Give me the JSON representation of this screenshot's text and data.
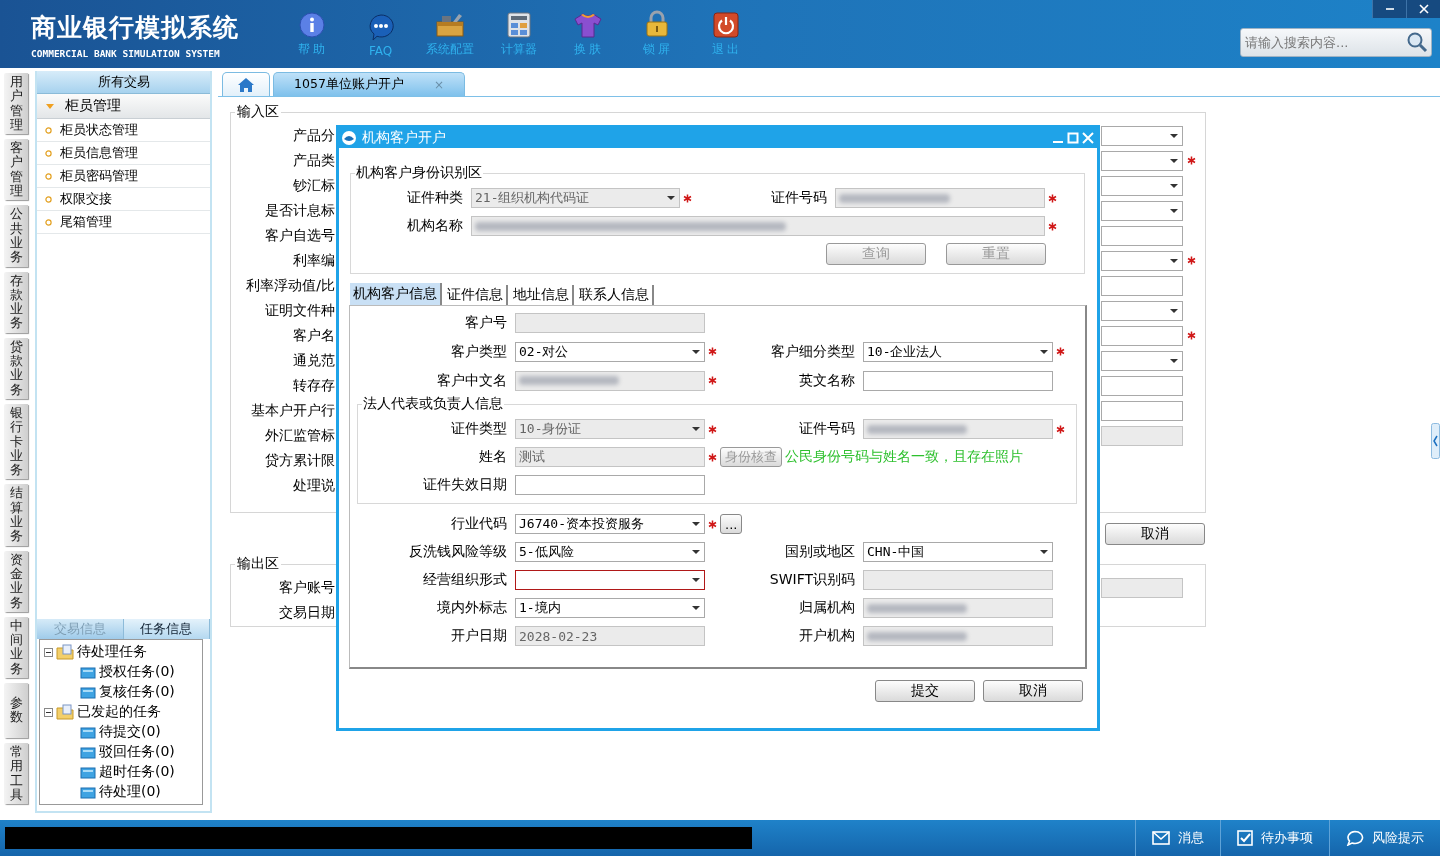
{
  "header": {
    "title": "商业银行模拟系统",
    "subtitle": "COMMERCIAL BANK SIMULATION SYSTEM",
    "toolbar": [
      {
        "kind": "info",
        "label": "帮 助"
      },
      {
        "kind": "faq",
        "label": "FAQ"
      },
      {
        "kind": "config",
        "label": "系统配置"
      },
      {
        "kind": "calculator",
        "label": "计算器"
      },
      {
        "kind": "skin",
        "label": "换 肤"
      },
      {
        "kind": "lock",
        "label": "锁 屏"
      },
      {
        "kind": "exit",
        "label": "退 出"
      }
    ],
    "search": {
      "placeholder": "请输入搜索内容..."
    }
  },
  "module_nav": [
    {
      "label": "用户管理"
    },
    {
      "label": "客户管理"
    },
    {
      "label": "公共业务"
    },
    {
      "label": "存款业务"
    },
    {
      "label": "贷款业务"
    },
    {
      "label": "银行卡业务"
    },
    {
      "label": "结算业务"
    },
    {
      "label": "资金业务"
    },
    {
      "label": "中间业务"
    },
    {
      "label": "参数"
    },
    {
      "label": "常用工具"
    }
  ],
  "sidebar": {
    "title": "所有交易",
    "group": {
      "label": "柜员管理",
      "expanded": true,
      "items": [
        {
          "label": "柜员状态管理"
        },
        {
          "label": "柜员信息管理"
        },
        {
          "label": "柜员密码管理"
        },
        {
          "label": "权限交接"
        },
        {
          "label": "尾箱管理"
        }
      ]
    },
    "bottom_tabs": [
      {
        "label": "交易信息",
        "selected": false
      },
      {
        "label": "任务信息",
        "selected": true
      }
    ],
    "tree": [
      {
        "label": "待处理任务",
        "expanded": true,
        "children": [
          {
            "label": "授权任务(0)"
          },
          {
            "label": "复核任务(0)"
          }
        ]
      },
      {
        "label": "已发起的任务",
        "expanded": true,
        "children": [
          {
            "label": "待提交(0)"
          },
          {
            "label": "驳回任务(0)"
          },
          {
            "label": "超时任务(0)"
          },
          {
            "label": "待处理(0)"
          }
        ]
      }
    ]
  },
  "tabs": [
    {
      "kind": "home",
      "selected": false
    },
    {
      "kind": "page",
      "label": "1057单位账户开户",
      "close": "×",
      "selected": true
    }
  ],
  "input_area": {
    "legend": "输入区",
    "rows": [
      {
        "label": "产品分",
        "field": {
          "kind": "select",
          "required": false,
          "disabled": false
        }
      },
      {
        "label": "产品类",
        "field": {
          "kind": "select",
          "required": true,
          "disabled": false
        }
      },
      {
        "label": "钞汇标",
        "field": {
          "kind": "select",
          "required": false,
          "disabled": false
        }
      },
      {
        "label": "是否计息标",
        "field": {
          "kind": "select",
          "required": false,
          "disabled": false
        }
      },
      {
        "label": "客户自选号",
        "field": {
          "kind": "input",
          "required": false,
          "disabled": false
        }
      },
      {
        "label": "利率编",
        "field": {
          "kind": "select",
          "required": true,
          "disabled": false
        }
      },
      {
        "label": "利率浮动值/比",
        "field": {
          "kind": "input",
          "required": false,
          "disabled": false
        }
      },
      {
        "label": "证明文件种",
        "field": {
          "kind": "select",
          "required": false,
          "disabled": false
        }
      },
      {
        "label": "客户名",
        "field": {
          "kind": "input",
          "required": true,
          "disabled": false
        }
      },
      {
        "label": "通兑范",
        "field": {
          "kind": "select",
          "required": false,
          "disabled": false
        }
      },
      {
        "label": "转存存",
        "field": {
          "kind": "input",
          "required": false,
          "disabled": false
        }
      },
      {
        "label": "基本户开户行",
        "field": {
          "kind": "input",
          "required": false,
          "disabled": false
        }
      },
      {
        "label": "外汇监管标",
        "field": {
          "kind": "input",
          "required": false,
          "disabled": true
        }
      },
      {
        "label": "贷方累计限"
      },
      {
        "label": "处理说"
      }
    ]
  },
  "cancel_button": "取消",
  "output_area": {
    "legend": "输出区",
    "rows": [
      {
        "label": "客户账号",
        "field": {
          "kind": "input",
          "required": false,
          "disabled": true
        }
      },
      {
        "label": "交易日期"
      }
    ]
  },
  "dialog": {
    "title": "机构客户开户",
    "identity": {
      "legend": "机构客户身份识别区",
      "doc_type": {
        "label": "证件种类",
        "kind": "select",
        "value": "21-组织机构代码证",
        "disabled": true,
        "required": true,
        "redacted": false,
        "invalid": false
      },
      "doc_number": {
        "label": "证件号码",
        "kind": "input",
        "disabled": true,
        "required": true,
        "redacted": true,
        "invalid": false
      },
      "org_name": {
        "label": "机构名称",
        "kind": "input",
        "disabled": true,
        "required": true,
        "redacted": true,
        "invalid": false
      },
      "buttons": [
        {
          "label": "查询",
          "disabled": true
        },
        {
          "label": "重置",
          "disabled": true
        }
      ]
    },
    "tabs": [
      {
        "label": "机构客户信息",
        "selected": true
      },
      {
        "label": "证件信息",
        "selected": false
      },
      {
        "label": "地址信息",
        "selected": false
      },
      {
        "label": "联系人信息",
        "selected": false
      }
    ],
    "rows": [
      {
        "left": {
          "label": "客户号",
          "kind": "input",
          "disabled": true,
          "required": false,
          "redacted": false,
          "invalid": false
        }
      },
      {
        "left": {
          "label": "客户类型",
          "kind": "select",
          "value": "02-对公",
          "disabled": false,
          "required": true,
          "redacted": false,
          "invalid": false
        },
        "right": {
          "label": "客户细分类型",
          "kind": "select",
          "value": "10-企业法人",
          "disabled": false,
          "required": true,
          "redacted": false,
          "invalid": false
        }
      },
      {
        "left": {
          "label": "客户中文名",
          "kind": "input",
          "disabled": true,
          "required": true,
          "redacted": true,
          "invalid": false
        },
        "right": {
          "label": "英文名称",
          "kind": "input",
          "disabled": false,
          "required": false,
          "redacted": false,
          "invalid": false
        }
      }
    ],
    "legal_rep": {
      "legend": "法人代表或负责人信息",
      "rows": [
        {
          "left": {
            "label": "证件类型",
            "kind": "select",
            "value": "10-身份证",
            "disabled": true,
            "required": true,
            "redacted": false,
            "invalid": false
          },
          "right": {
            "label": "证件号码",
            "kind": "input",
            "disabled": true,
            "required": true,
            "redacted": true,
            "invalid": false
          }
        },
        {
          "left": {
            "label": "姓名",
            "kind": "input",
            "value": "测试",
            "disabled": true,
            "required": true,
            "redacted": false,
            "invalid": false,
            "action": {
              "label": "身份核查",
              "disabled": true
            },
            "message": "公民身份号码与姓名一致，且存在照片"
          }
        },
        {
          "left": {
            "label": "证件失效日期",
            "kind": "input",
            "disabled": false,
            "required": false,
            "redacted": false,
            "invalid": false
          }
        }
      ]
    },
    "more_rows": [
      {
        "left": {
          "label": "行业代码",
          "kind": "select",
          "value": "J6740-资本投资服务",
          "disabled": false,
          "required": true,
          "redacted": false,
          "invalid": false,
          "action": {
            "label": "...",
            "disabled": false
          }
        }
      },
      {
        "left": {
          "label": "反洗钱风险等级",
          "kind": "select",
          "value": "5-低风险",
          "disabled": false,
          "required": false,
          "redacted": false,
          "invalid": false
        },
        "right": {
          "label": "国别或地区",
          "kind": "select",
          "value": "CHN-中国",
          "disabled": false,
          "required": false,
          "redacted": false,
          "invalid": false
        }
      },
      {
        "left": {
          "label": "经营组织形式",
          "kind": "select",
          "disabled": false,
          "required": false,
          "redacted": false,
          "invalid": true
        },
        "right": {
          "label": "SWIFT识别码",
          "kind": "input",
          "disabled": true,
          "required": false,
          "redacted": false,
          "invalid": false
        }
      },
      {
        "left": {
          "label": "境内外标志",
          "kind": "select",
          "value": "1-境内",
          "disabled": false,
          "required": false,
          "redacted": false,
          "invalid": false
        },
        "right": {
          "label": "归属机构",
          "kind": "input",
          "disabled": true,
          "required": false,
          "redacted": true,
          "invalid": false
        }
      },
      {
        "left": {
          "label": "开户日期",
          "kind": "input",
          "value": "2028-02-23",
          "disabled": true,
          "required": false,
          "redacted": false,
          "invalid": false
        },
        "right": {
          "label": "开户机构",
          "kind": "input",
          "disabled": true,
          "required": false,
          "redacted": true,
          "invalid": false
        }
      }
    ],
    "buttons": [
      {
        "label": "提交",
        "disabled": false
      },
      {
        "label": "取消",
        "disabled": false
      }
    ]
  },
  "status_bar": {
    "items": [
      {
        "kind": "message",
        "label": "消息"
      },
      {
        "kind": "todo",
        "label": "待办事项"
      },
      {
        "kind": "risk",
        "label": "风险提示"
      }
    ]
  }
}
